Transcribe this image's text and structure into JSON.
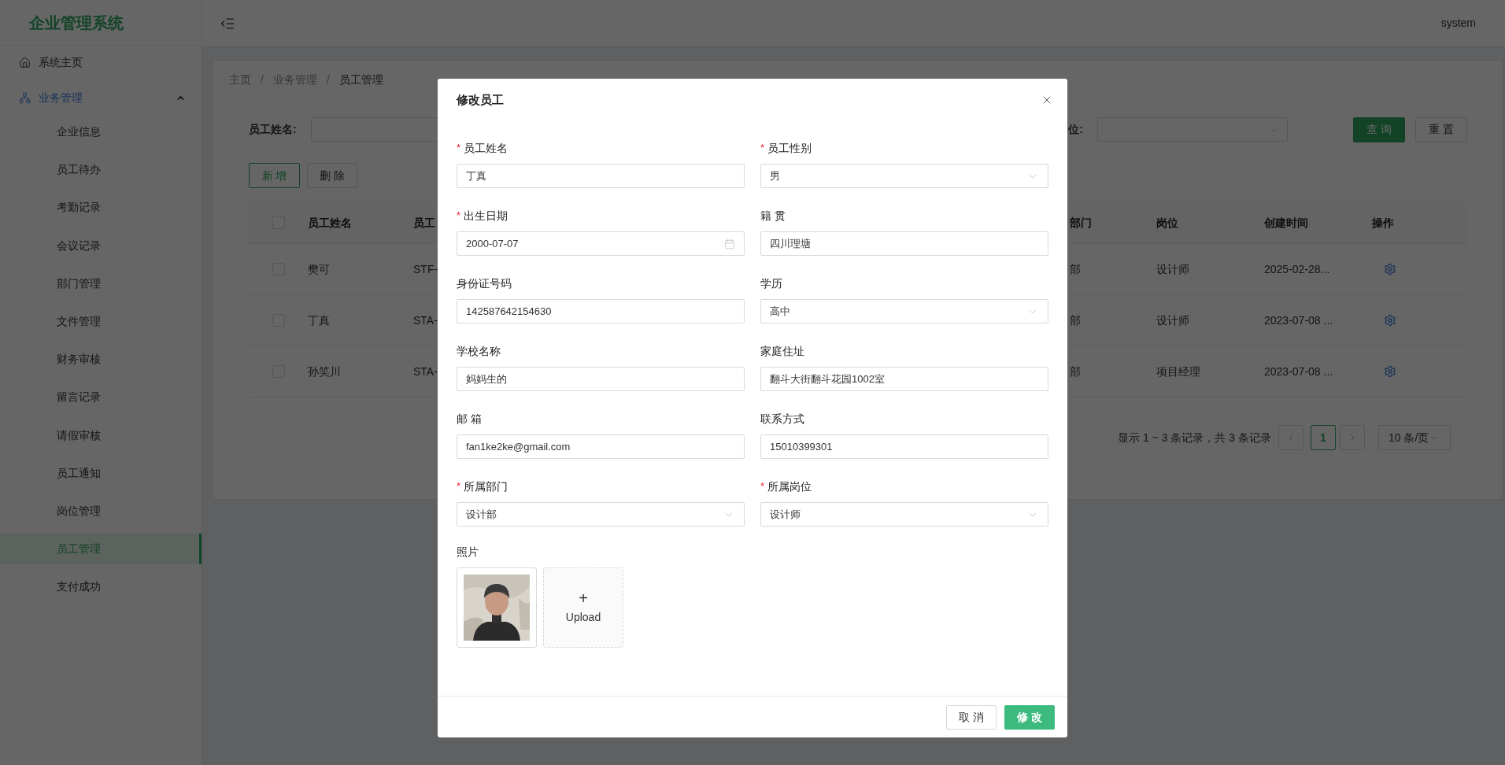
{
  "app_title": "企业管理系统",
  "header": {
    "user": "system"
  },
  "sidebar": {
    "items": [
      {
        "kind": "link",
        "label": "系统主页",
        "selected": false
      },
      {
        "kind": "group",
        "label": "业务管理",
        "expanded": true,
        "children": [
          {
            "label": "企业信息",
            "selected": false
          },
          {
            "label": "员工待办",
            "selected": false
          },
          {
            "label": "考勤记录",
            "selected": false
          },
          {
            "label": "会议记录",
            "selected": false
          },
          {
            "label": "部门管理",
            "selected": false
          },
          {
            "label": "文件管理",
            "selected": false
          },
          {
            "label": "财务审核",
            "selected": false
          },
          {
            "label": "留言记录",
            "selected": false
          },
          {
            "label": "请假审核",
            "selected": false
          },
          {
            "label": "员工通知",
            "selected": false
          },
          {
            "label": "岗位管理",
            "selected": false
          },
          {
            "label": "员工管理",
            "selected": true
          },
          {
            "label": "支付成功",
            "selected": false
          }
        ]
      }
    ]
  },
  "breadcrumb": [
    "主页",
    "业务管理",
    "员工管理"
  ],
  "breadcrumb_separator": "/",
  "filters": {
    "name_label": "员工姓名:",
    "post_label": "位:",
    "query_button": "查 询",
    "reset_button": "重 置"
  },
  "actions": {
    "add": "新 增",
    "delete": "删 除"
  },
  "table": {
    "header_checked": false,
    "columns": [
      "员工姓名",
      "员工",
      "部门",
      "岗位",
      "创建时间",
      "操作"
    ],
    "rows": [
      {
        "checked": false,
        "name": "樊可",
        "code": "STF-",
        "dept": "部",
        "post": "设计师",
        "created": "2025-02-28..."
      },
      {
        "checked": false,
        "name": "丁真",
        "code": "STA-",
        "dept": "部",
        "post": "设计师",
        "created": "2023-07-08 ..."
      },
      {
        "checked": false,
        "name": "孙笑川",
        "code": "STA-",
        "dept": "部",
        "post": "项目经理",
        "created": "2023-07-08 ..."
      }
    ]
  },
  "pagination": {
    "summary": "显示 1 ~ 3 条记录，共 3 条记录",
    "pages": [
      {
        "label": "1",
        "selected": true
      }
    ],
    "page_size": "10 条/页"
  },
  "dialog": {
    "title": "修改员工",
    "fields": [
      {
        "kind": "text",
        "label": "员工姓名",
        "required": true,
        "value": "丁真"
      },
      {
        "kind": "select",
        "label": "员工性别",
        "required": true,
        "value": "男"
      },
      {
        "kind": "date",
        "label": "出生日期",
        "required": true,
        "value": "2000-07-07"
      },
      {
        "kind": "text",
        "label": "籍 贯",
        "required": false,
        "value": "四川理塘"
      },
      {
        "kind": "text",
        "label": "身份证号码",
        "required": false,
        "value": "142587642154630"
      },
      {
        "kind": "select",
        "label": "学历",
        "required": false,
        "value": "高中"
      },
      {
        "kind": "text",
        "label": "学校名称",
        "required": false,
        "value": "妈妈生的"
      },
      {
        "kind": "text",
        "label": "家庭住址",
        "required": false,
        "value": "翻斗大街翻斗花园1002室"
      },
      {
        "kind": "text",
        "label": "邮 箱",
        "required": false,
        "value": "fan1ke2ke@gmail.com"
      },
      {
        "kind": "text",
        "label": "联系方式",
        "required": false,
        "value": "15010399301"
      },
      {
        "kind": "select",
        "label": "所属部门",
        "required": true,
        "value": "设计部"
      },
      {
        "kind": "select",
        "label": "所属岗位",
        "required": true,
        "value": "设计师"
      }
    ],
    "required_mark": "*",
    "photo": {
      "label": "照片",
      "upload_plus": "+",
      "upload_text": "Upload"
    },
    "buttons": [
      {
        "kind": "default",
        "label": "取 消"
      },
      {
        "kind": "primary",
        "label": "修 改"
      }
    ]
  }
}
